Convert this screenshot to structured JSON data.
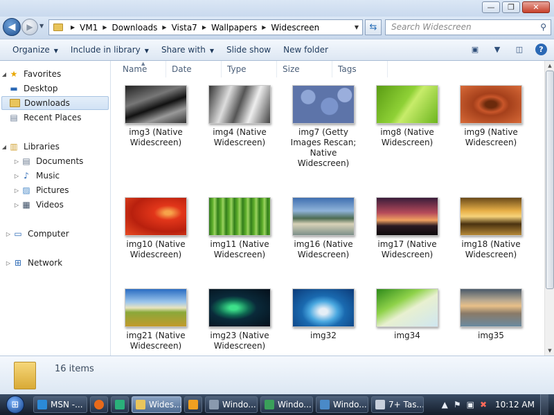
{
  "window": {
    "controls": {
      "minimize": "—",
      "maximize": "❐",
      "close": "✕"
    }
  },
  "nav": {
    "back_icon": "back-arrow",
    "forward_icon": "forward-arrow",
    "breadcrumbs": [
      "VM1",
      "Downloads",
      "Vista7",
      "Wallpapers",
      "Widescreen"
    ],
    "search_placeholder": "Search Widescreen"
  },
  "toolbar": {
    "organize": "Organize",
    "include_in_library": "Include in library",
    "share_with": "Share with",
    "slide_show": "Slide show",
    "new_folder": "New folder"
  },
  "sidebar": {
    "favorites": "Favorites",
    "desktop": "Desktop",
    "downloads": "Downloads",
    "recent_places": "Recent Places",
    "libraries": "Libraries",
    "documents": "Documents",
    "music": "Music",
    "pictures": "Pictures",
    "videos": "Videos",
    "computer": "Computer",
    "network": "Network"
  },
  "columns": [
    "Name",
    "Date",
    "Type",
    "Size",
    "Tags"
  ],
  "files": [
    {
      "name": "img3 (Native Widescreen)"
    },
    {
      "name": "img4 (Native Widescreen)"
    },
    {
      "name": "img7 (Getty Images Rescan; Native Widescreen)"
    },
    {
      "name": "img8 (Native Widescreen)"
    },
    {
      "name": "img9 (Native Widescreen)"
    },
    {
      "name": "img10 (Native Widescreen)"
    },
    {
      "name": "img11 (Native Widescreen)"
    },
    {
      "name": "img16 (Native Widescreen)"
    },
    {
      "name": "img17 (Native Widescreen)"
    },
    {
      "name": "img18 (Native Widescreen)"
    },
    {
      "name": "img21 (Native Widescreen)"
    },
    {
      "name": "img23 (Native Widescreen)"
    },
    {
      "name": "img32"
    },
    {
      "name": "img34"
    },
    {
      "name": "img35"
    }
  ],
  "details": {
    "item_count": "16 items"
  },
  "taskbar": {
    "tasks": [
      {
        "label": "MSN -...",
        "active": false
      },
      {
        "label": "Wides...",
        "active": true
      },
      {
        "label": "Windo...",
        "active": false
      },
      {
        "label": "Windo...",
        "active": false
      },
      {
        "label": "Windo...",
        "active": false
      },
      {
        "label": "7+ Tas...",
        "active": false
      }
    ],
    "clock": "10:12 AM"
  },
  "colors": {
    "accent": "#2b69b5",
    "taskbar": "#1c2738",
    "selection": "#d2e2f5"
  }
}
